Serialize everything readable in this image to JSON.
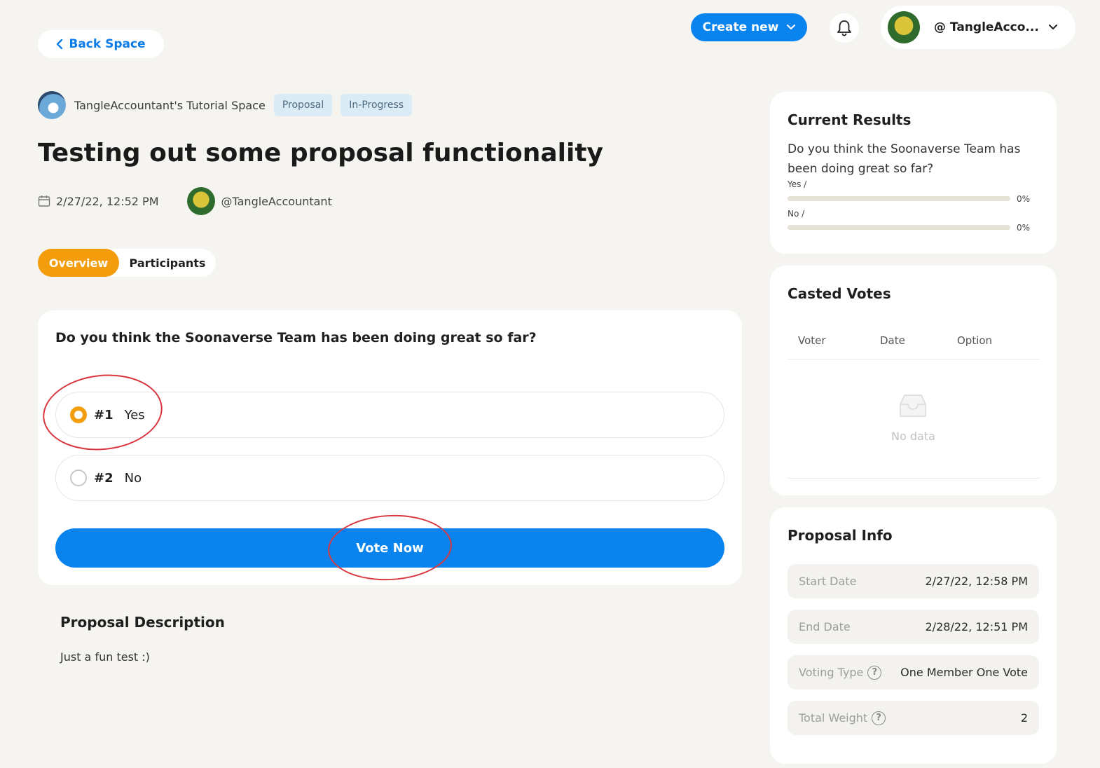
{
  "nav": {
    "back_label": "Back Space",
    "create_label": "Create new",
    "account_name": "@ TangleAcco..."
  },
  "space": {
    "name": "TangleAccountant's Tutorial Space",
    "tags": [
      "Proposal",
      "In-Progress"
    ]
  },
  "proposal": {
    "title": "Testing out some proposal functionality",
    "date": "2/27/22, 12:52 PM",
    "author": "@TangleAccountant"
  },
  "tabs": [
    {
      "label": "Overview",
      "active": true
    },
    {
      "label": "Participants",
      "active": false
    }
  ],
  "vote": {
    "question": "Do you think the Soonaverse Team has been doing great so far?",
    "options": [
      {
        "num": "#1",
        "label": "Yes",
        "selected": true
      },
      {
        "num": "#2",
        "label": "No",
        "selected": false
      }
    ],
    "button_label": "Vote Now"
  },
  "description": {
    "title": "Proposal Description",
    "text": "Just a fun test :)"
  },
  "results": {
    "title": "Current Results",
    "question": "Do you think the Soonaverse Team has been doing great so far?",
    "rows": [
      {
        "label": "Yes /",
        "percent": "0%",
        "fraction": 0
      },
      {
        "label": "No /",
        "percent": "0%",
        "fraction": 0
      }
    ]
  },
  "casted_votes": {
    "title": "Casted Votes",
    "columns": [
      "Voter",
      "Date",
      "Option"
    ],
    "empty_text": "No data"
  },
  "info": {
    "title": "Proposal Info",
    "rows": [
      {
        "label": "Start Date",
        "value": "2/27/22, 12:58 PM",
        "help": false
      },
      {
        "label": "End Date",
        "value": "2/28/22, 12:51 PM",
        "help": false
      },
      {
        "label": "Voting Type",
        "value": "One Member One Vote",
        "help": true
      },
      {
        "label": "Total Weight",
        "value": "2",
        "help": true
      }
    ]
  },
  "colors": {
    "primary": "#0984ee",
    "accent": "#f39c0c",
    "annotation": "#d9373f",
    "background": "#f5f4f0"
  }
}
